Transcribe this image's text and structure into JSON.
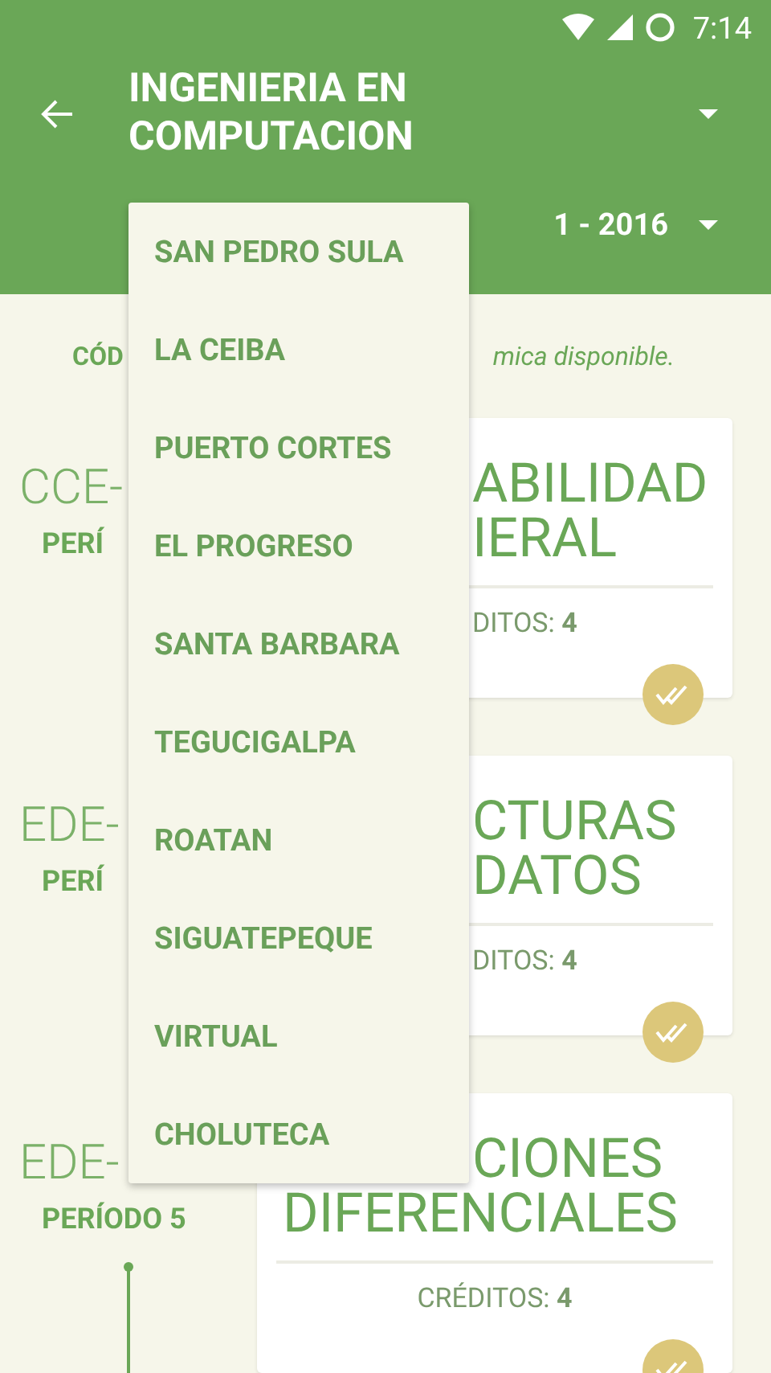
{
  "status_bar": {
    "time": "7:14"
  },
  "toolbar": {
    "title": "INGENIERIA EN COMPUTACION",
    "period": "1 - 2016"
  },
  "notice": {
    "label": "CÓD",
    "text": "mica disponible."
  },
  "courses": [
    {
      "code": "CCE-",
      "period": "PERÍ",
      "title_lines": [
        {
          "text": "ABILIDAD",
          "kind": "partial"
        },
        {
          "text": "IERAL",
          "kind": "partial"
        }
      ],
      "credits": {
        "text": "DITOS: **4**",
        "kind": "partial"
      },
      "done": true
    },
    {
      "code": "EDE-",
      "period": "PERÍ",
      "title_lines": [
        {
          "text": "CTURAS",
          "kind": "partial"
        },
        {
          "text": "DATOS",
          "kind": "partial"
        }
      ],
      "credits": {
        "text": "DITOS: **4**",
        "kind": "partial"
      },
      "done": true
    },
    {
      "code": "EDE-",
      "period": "PERÍODO 5",
      "title_lines": [
        {
          "text": "CIONES",
          "kind": "partial"
        },
        {
          "text": "DIFERENCIALES",
          "kind": "full"
        }
      ],
      "credits": {
        "text": "CRÉDITOS: **4**",
        "kind": "full"
      },
      "done": true
    }
  ],
  "campus_menu": {
    "items": [
      {
        "label": "SAN PEDRO SULA"
      },
      {
        "label": "LA CEIBA"
      },
      {
        "label": "PUERTO CORTES"
      },
      {
        "label": "EL PROGRESO"
      },
      {
        "label": "SANTA BARBARA"
      },
      {
        "label": "TEGUCIGALPA"
      },
      {
        "label": "ROATAN"
      },
      {
        "label": "SIGUATEPEQUE"
      },
      {
        "label": "VIRTUAL"
      },
      {
        "label": "CHOLUTECA"
      }
    ]
  }
}
